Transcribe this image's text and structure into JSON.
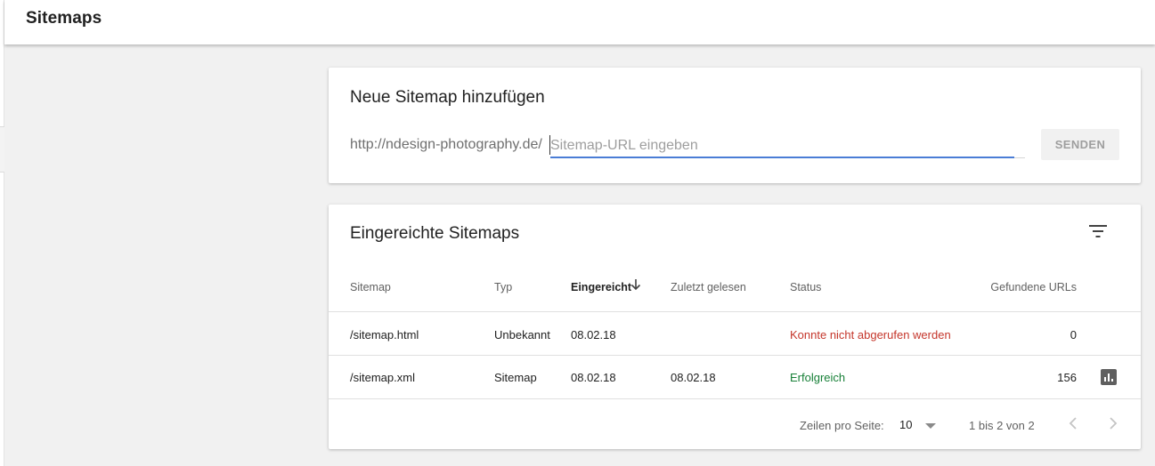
{
  "header": {
    "title": "Sitemaps"
  },
  "add_card": {
    "title": "Neue Sitemap hinzufügen",
    "url_prefix": "http://ndesign-photography.de/",
    "input_placeholder": "Sitemap-URL eingeben",
    "input_value": "",
    "send_label": "SENDEN"
  },
  "list_card": {
    "title": "Eingereichte Sitemaps",
    "filter_icon": "filter-list-icon",
    "columns": {
      "sitemap": "Sitemap",
      "typ": "Typ",
      "eingereicht": "Eingereicht",
      "zuletzt": "Zuletzt gelesen",
      "status": "Status",
      "urls": "Gefundene URLs"
    },
    "sorted_column": "eingereicht",
    "rows": [
      {
        "sitemap": "/sitemap.html",
        "typ": "Unbekannt",
        "eingereicht": "08.02.18",
        "zuletzt": "",
        "status": "Konnte nicht abgerufen werden",
        "urls": "0"
      },
      {
        "sitemap": "/sitemap.xml",
        "typ": "Sitemap",
        "eingereicht": "08.02.18",
        "zuletzt": "08.02.18",
        "status": "Erfolgreich",
        "urls": "156"
      }
    ],
    "pagination": {
      "rows_label": "Zeilen pro Seite:",
      "rows_value": "10",
      "range": "1 bis 2 von 2"
    }
  },
  "colors": {
    "accent_blue": "#4a7dd6",
    "status_error": "#c5362b",
    "status_ok": "#188038"
  }
}
